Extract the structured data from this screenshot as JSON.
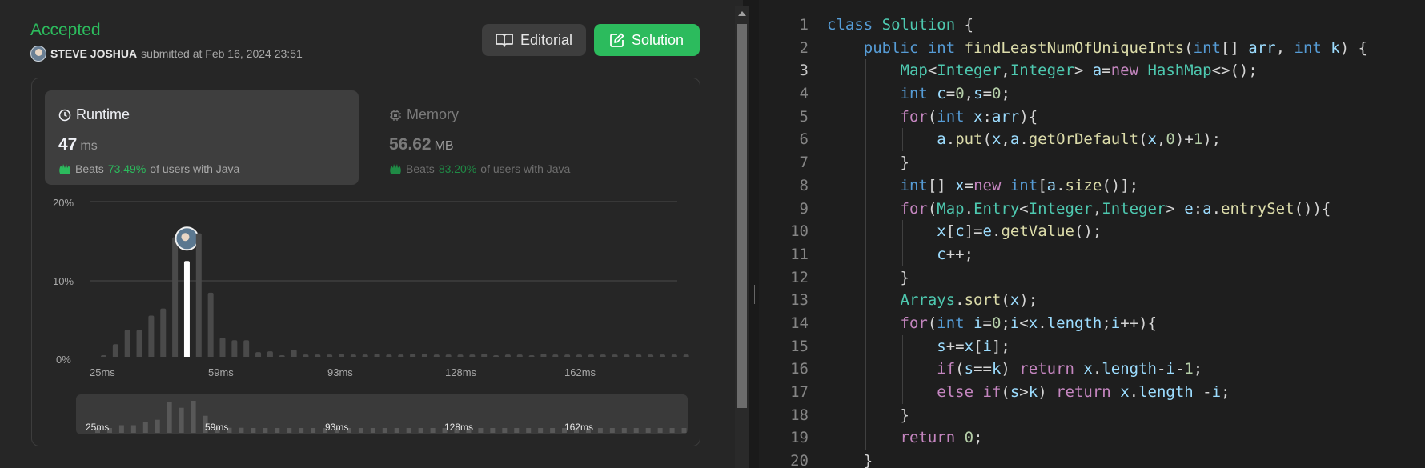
{
  "submission": {
    "status": "Accepted",
    "submitter_name": "STEVE JOSHUA",
    "submitted_text": "submitted at Feb 16, 2024 23:51",
    "editorial_label": "Editorial",
    "solution_label": "Solution"
  },
  "runtime": {
    "label": "Runtime",
    "value": "47",
    "unit": "ms",
    "beats_prefix": "Beats",
    "beats_pct": "73.49%",
    "beats_suffix": "of users with Java"
  },
  "memory": {
    "label": "Memory",
    "value": "56.62",
    "unit": "MB",
    "beats_prefix": "Beats",
    "beats_pct": "83.20%",
    "beats_suffix": "of users with Java"
  },
  "chart_data": {
    "type": "bar",
    "y_ticks": [
      "20%",
      "10%",
      "0%"
    ],
    "ylim": [
      0,
      20
    ],
    "x_ticks": [
      "25ms",
      "59ms",
      "93ms",
      "128ms",
      "162ms"
    ],
    "highlight_index": 7,
    "values": [
      0.6,
      2.0,
      3.8,
      3.8,
      5.6,
      6.5,
      15.5,
      12.5,
      16.0,
      8.5,
      2.8,
      2.5,
      2.5,
      1.0,
      1.1,
      0.6,
      1.3,
      0.7,
      0.7,
      0.7,
      0.8,
      0.7,
      0.7,
      0.8,
      0.7,
      0.7,
      0.8,
      0.8,
      0.7,
      0.7,
      0.7,
      0.7,
      0.8,
      0.6,
      0.7,
      0.7,
      0.6,
      0.8,
      0.7,
      0.7,
      0.7,
      0.7,
      0.7,
      0.7,
      0.7,
      0.7,
      0.7,
      0.7,
      0.7,
      0.7
    ]
  },
  "minimap": {
    "x_ticks": [
      "25ms",
      "59ms",
      "93ms",
      "128ms",
      "162ms"
    ]
  },
  "code": {
    "active_line": 3,
    "lines": [
      [
        [
          "kw",
          "class"
        ],
        [
          "t",
          " "
        ],
        [
          "cls",
          "Solution"
        ],
        [
          "t",
          " {"
        ]
      ],
      [
        [
          "t",
          "    "
        ],
        [
          "kw",
          "public"
        ],
        [
          "t",
          " "
        ],
        [
          "kw",
          "int"
        ],
        [
          "t",
          " "
        ],
        [
          "fn",
          "findLeastNumOfUniqueInts"
        ],
        [
          "t",
          "("
        ],
        [
          "kw",
          "int"
        ],
        [
          "t",
          "[] "
        ],
        [
          "var",
          "arr"
        ],
        [
          "t",
          ", "
        ],
        [
          "kw",
          "int"
        ],
        [
          "t",
          " "
        ],
        [
          "var",
          "k"
        ],
        [
          "t",
          ") {"
        ]
      ],
      [
        [
          "t",
          "        "
        ],
        [
          "cls",
          "Map"
        ],
        [
          "t",
          "<"
        ],
        [
          "cls",
          "Integer"
        ],
        [
          "t",
          ","
        ],
        [
          "cls",
          "Integer"
        ],
        [
          "t",
          "> "
        ],
        [
          "var",
          "a"
        ],
        [
          "t",
          "="
        ],
        [
          "kw2",
          "new"
        ],
        [
          "t",
          " "
        ],
        [
          "cls",
          "HashMap"
        ],
        [
          "t",
          "<>();"
        ]
      ],
      [
        [
          "t",
          "        "
        ],
        [
          "kw",
          "int"
        ],
        [
          "t",
          " "
        ],
        [
          "var",
          "c"
        ],
        [
          "t",
          "="
        ],
        [
          "num",
          "0"
        ],
        [
          "t",
          ","
        ],
        [
          "var",
          "s"
        ],
        [
          "t",
          "="
        ],
        [
          "num",
          "0"
        ],
        [
          "t",
          ";"
        ]
      ],
      [
        [
          "t",
          "        "
        ],
        [
          "kw2",
          "for"
        ],
        [
          "t",
          "("
        ],
        [
          "kw",
          "int"
        ],
        [
          "t",
          " "
        ],
        [
          "var",
          "x"
        ],
        [
          "t",
          ":"
        ],
        [
          "var",
          "arr"
        ],
        [
          "t",
          "){"
        ]
      ],
      [
        [
          "t",
          "            "
        ],
        [
          "var",
          "a"
        ],
        [
          "t",
          "."
        ],
        [
          "fn",
          "put"
        ],
        [
          "t",
          "("
        ],
        [
          "var",
          "x"
        ],
        [
          "t",
          ","
        ],
        [
          "var",
          "a"
        ],
        [
          "t",
          "."
        ],
        [
          "fn",
          "getOrDefault"
        ],
        [
          "t",
          "("
        ],
        [
          "var",
          "x"
        ],
        [
          "t",
          ","
        ],
        [
          "num",
          "0"
        ],
        [
          "t",
          ")+"
        ],
        [
          "num",
          "1"
        ],
        [
          "t",
          ");"
        ]
      ],
      [
        [
          "t",
          "        }"
        ]
      ],
      [
        [
          "t",
          "        "
        ],
        [
          "kw",
          "int"
        ],
        [
          "t",
          "[] "
        ],
        [
          "var",
          "x"
        ],
        [
          "t",
          "="
        ],
        [
          "kw2",
          "new"
        ],
        [
          "t",
          " "
        ],
        [
          "kw",
          "int"
        ],
        [
          "t",
          "["
        ],
        [
          "var",
          "a"
        ],
        [
          "t",
          "."
        ],
        [
          "fn",
          "size"
        ],
        [
          "t",
          "()];"
        ]
      ],
      [
        [
          "t",
          "        "
        ],
        [
          "kw2",
          "for"
        ],
        [
          "t",
          "("
        ],
        [
          "cls",
          "Map"
        ],
        [
          "t",
          "."
        ],
        [
          "cls",
          "Entry"
        ],
        [
          "t",
          "<"
        ],
        [
          "cls",
          "Integer"
        ],
        [
          "t",
          ","
        ],
        [
          "cls",
          "Integer"
        ],
        [
          "t",
          "> "
        ],
        [
          "var",
          "e"
        ],
        [
          "t",
          ":"
        ],
        [
          "var",
          "a"
        ],
        [
          "t",
          "."
        ],
        [
          "fn",
          "entrySet"
        ],
        [
          "t",
          "()){"
        ]
      ],
      [
        [
          "t",
          "            "
        ],
        [
          "var",
          "x"
        ],
        [
          "t",
          "["
        ],
        [
          "var",
          "c"
        ],
        [
          "t",
          "]="
        ],
        [
          "var",
          "e"
        ],
        [
          "t",
          "."
        ],
        [
          "fn",
          "getValue"
        ],
        [
          "t",
          "();"
        ]
      ],
      [
        [
          "t",
          "            "
        ],
        [
          "var",
          "c"
        ],
        [
          "t",
          "++;"
        ]
      ],
      [
        [
          "t",
          "        }"
        ]
      ],
      [
        [
          "t",
          "        "
        ],
        [
          "cls",
          "Arrays"
        ],
        [
          "t",
          "."
        ],
        [
          "fn",
          "sort"
        ],
        [
          "t",
          "("
        ],
        [
          "var",
          "x"
        ],
        [
          "t",
          ");"
        ]
      ],
      [
        [
          "t",
          "        "
        ],
        [
          "kw2",
          "for"
        ],
        [
          "t",
          "("
        ],
        [
          "kw",
          "int"
        ],
        [
          "t",
          " "
        ],
        [
          "var",
          "i"
        ],
        [
          "t",
          "="
        ],
        [
          "num",
          "0"
        ],
        [
          "t",
          ";"
        ],
        [
          "var",
          "i"
        ],
        [
          "t",
          "<"
        ],
        [
          "var",
          "x"
        ],
        [
          "t",
          "."
        ],
        [
          "var",
          "length"
        ],
        [
          "t",
          ";"
        ],
        [
          "var",
          "i"
        ],
        [
          "t",
          "++){"
        ]
      ],
      [
        [
          "t",
          "            "
        ],
        [
          "var",
          "s"
        ],
        [
          "t",
          "+="
        ],
        [
          "var",
          "x"
        ],
        [
          "t",
          "["
        ],
        [
          "var",
          "i"
        ],
        [
          "t",
          "];"
        ]
      ],
      [
        [
          "t",
          "            "
        ],
        [
          "kw2",
          "if"
        ],
        [
          "t",
          "("
        ],
        [
          "var",
          "s"
        ],
        [
          "t",
          "=="
        ],
        [
          "var",
          "k"
        ],
        [
          "t",
          ") "
        ],
        [
          "kw2",
          "return"
        ],
        [
          "t",
          " "
        ],
        [
          "var",
          "x"
        ],
        [
          "t",
          "."
        ],
        [
          "var",
          "length"
        ],
        [
          "t",
          "-"
        ],
        [
          "var",
          "i"
        ],
        [
          "t",
          "-"
        ],
        [
          "num",
          "1"
        ],
        [
          "t",
          ";"
        ]
      ],
      [
        [
          "t",
          "            "
        ],
        [
          "kw2",
          "else"
        ],
        [
          "t",
          " "
        ],
        [
          "kw2",
          "if"
        ],
        [
          "t",
          "("
        ],
        [
          "var",
          "s"
        ],
        [
          "t",
          ">"
        ],
        [
          "var",
          "k"
        ],
        [
          "t",
          ") "
        ],
        [
          "kw2",
          "return"
        ],
        [
          "t",
          " "
        ],
        [
          "var",
          "x"
        ],
        [
          "t",
          "."
        ],
        [
          "var",
          "length"
        ],
        [
          "t",
          " -"
        ],
        [
          "var",
          "i"
        ],
        [
          "t",
          ";"
        ]
      ],
      [
        [
          "t",
          "        }"
        ]
      ],
      [
        [
          "t",
          "        "
        ],
        [
          "kw2",
          "return"
        ],
        [
          "t",
          " "
        ],
        [
          "num",
          "0"
        ],
        [
          "t",
          ";"
        ]
      ],
      [
        [
          "t",
          "    }"
        ]
      ]
    ]
  },
  "colors": {
    "accent_green": "#2cbb5d",
    "kw": "#569cd6",
    "kw2": "#c586c0",
    "cls": "#4ec9b0",
    "fn": "#dcdcaa",
    "var": "#9cdcfe",
    "num": "#b5cea8"
  }
}
